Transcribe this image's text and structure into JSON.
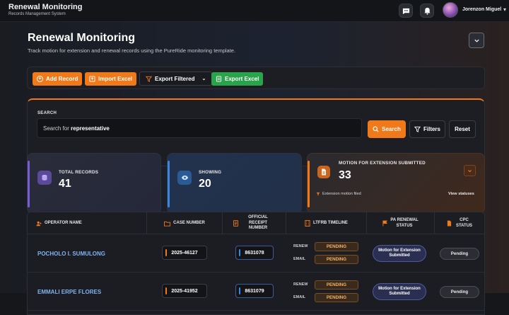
{
  "app": {
    "title": "Renewal Monitoring",
    "subtitle": "Records Management System"
  },
  "user": {
    "name": "Jorenzon Miguel"
  },
  "header": {
    "title": "Renewal Monitoring",
    "description": "Track motion for extension and renewal records using the PureRide monitoring template."
  },
  "toolbar": {
    "add_record": "Add Record",
    "import_excel": "Import Excel",
    "export_filtered": "Export Filtered",
    "export_excel": "Export Excel"
  },
  "search": {
    "label": "SEARCH",
    "prefix": "Search for",
    "term": "representative",
    "search_btn": "Search",
    "filters_btn": "Filters",
    "reset_btn": "Reset"
  },
  "stats": {
    "total": {
      "label": "TOTAL RECORDS",
      "value": "41"
    },
    "showing": {
      "label": "SHOWING",
      "value": "20"
    },
    "motion": {
      "label": "MOTION FOR EXTENSION SUBMITTED",
      "value": "33",
      "note": "Extension motion filed",
      "link": "View statuses"
    }
  },
  "table": {
    "headers": {
      "operator": "OPERATOR NAME",
      "case": "CASE NUMBER",
      "receipt": "OFFICIAL RECEIPT NUMBER",
      "timeline": "LTFRB TIMELINE",
      "pa": "PA RENEWAL STATUS",
      "cpc": "CPC STATUS"
    },
    "timeline_labels": {
      "renew": "RENEW",
      "email": "EMAIL"
    },
    "rows": [
      {
        "operator": "POCHOLO I. SUMULONG",
        "case": "2025-46127",
        "receipt": "8631078",
        "renew": "PENDING",
        "email": "PENDING",
        "pa": "Motion for Extension Submitted",
        "cpc": "Pending"
      },
      {
        "operator": "EMMALI ERPE FLORES",
        "case": "2025-41952",
        "receipt": "8631079",
        "renew": "PENDING",
        "email": "PENDING",
        "pa": "Motion for Extension Submitted",
        "cpc": "Pending"
      }
    ]
  },
  "colors": {
    "accent": "#f07a1a",
    "green": "#2aa44a",
    "link": "#7fb3f0",
    "pending": "#f3b46a"
  }
}
